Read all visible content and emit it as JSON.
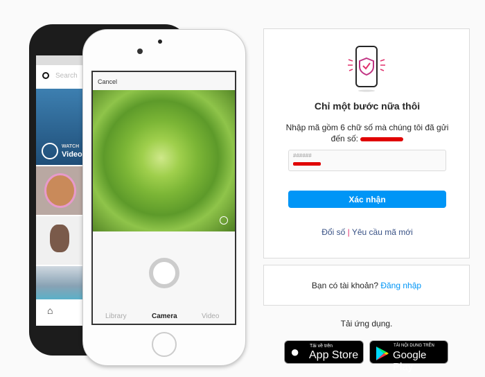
{
  "phones": {
    "back": {
      "search_placeholder": "Search",
      "watch_label": "WATCH",
      "video_label": "Video"
    },
    "front": {
      "cancel": "Cancel",
      "tabs": [
        "Library",
        "Camera",
        "Video"
      ]
    }
  },
  "verify": {
    "title": "Chỉ một bước nữa thôi",
    "description_line1": "Nhập mã gồm 6 chữ số mà chúng tôi đã gửi",
    "description_line2": "đến số:",
    "code_placeholder": "######",
    "confirm_button": "Xác nhận",
    "change_number": "Đổi số",
    "separator": "|",
    "request_new_code": "Yêu cầu mã mới"
  },
  "login": {
    "prompt": "Bạn có tài khoản?",
    "link": "Đăng nhập"
  },
  "download": {
    "label": "Tải ứng dụng.",
    "app_store": {
      "small": "Tải về trên",
      "big": "App Store"
    },
    "google_play": {
      "small": "TẢI NỘI DUNG TRÊN",
      "big": "Google Play"
    }
  },
  "colors": {
    "accent": "#0095f6",
    "link": "#385185",
    "redaction": "#e00000"
  }
}
